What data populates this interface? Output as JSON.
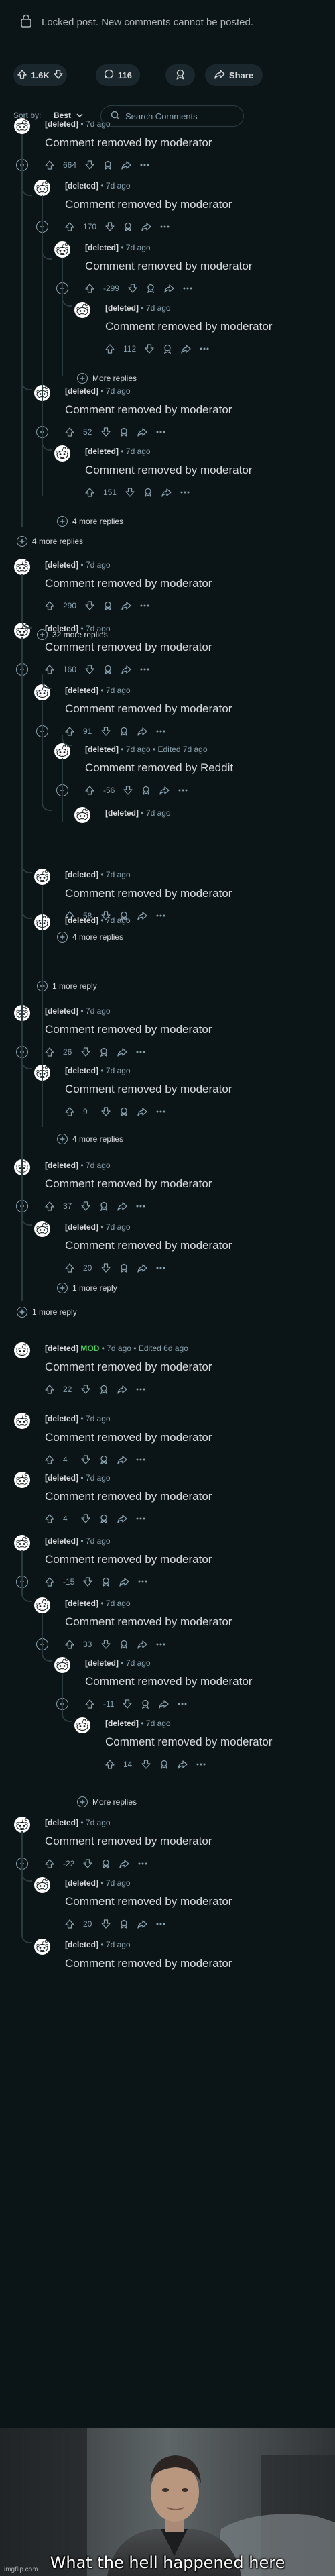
{
  "locked_notice": "Locked post. New comments cannot be posted.",
  "post_actions": {
    "vote_count": "1.6K",
    "comment_count": "116",
    "share_label": "Share"
  },
  "sort": {
    "label": "Sort by:",
    "value": "Best"
  },
  "search": {
    "placeholder": "Search Comments"
  },
  "comments": [
    {
      "author": "[deleted]",
      "time": "7d ago",
      "body": "Comment removed by moderator",
      "score": "664",
      "collapse": true
    },
    {
      "author": "[deleted]",
      "time": "7d ago",
      "body": "Comment removed by moderator",
      "score": "170",
      "collapse": true
    },
    {
      "author": "[deleted]",
      "time": "7d ago",
      "body": "Comment removed by moderator",
      "score": "-299",
      "collapse": true
    },
    {
      "author": "[deleted]",
      "time": "7d ago",
      "body": "Comment removed by moderator",
      "score": "112",
      "collapse": false
    },
    {
      "author": "[deleted]",
      "time": "7d ago",
      "body": "Comment removed by moderator",
      "score": "52",
      "collapse": true
    },
    {
      "author": "[deleted]",
      "time": "7d ago",
      "body": "Comment removed by moderator",
      "score": "151",
      "collapse": false
    },
    {
      "author": "[deleted]",
      "time": "7d ago",
      "body": "Comment removed by moderator",
      "score": "290",
      "collapse": false
    },
    {
      "author": "[deleted]",
      "time": "7d ago",
      "body": "Comment removed by moderator",
      "score": "160",
      "collapse": true
    },
    {
      "author": "[deleted]",
      "time": "7d ago",
      "body": "Comment removed by moderator",
      "score": "91",
      "collapse": true
    },
    {
      "author": "[deleted]",
      "time": "7d ago",
      "edited": "Edited 7d ago",
      "body": "Comment removed by Reddit",
      "score": "-56",
      "collapse": true
    },
    {
      "author": "[deleted]",
      "time": "7d ago",
      "body": "",
      "score": "",
      "collapse": false
    },
    {
      "author": "[deleted]",
      "time": "7d ago",
      "body": "Comment removed by moderator",
      "score": "58",
      "collapse": false
    },
    {
      "author": "[deleted]",
      "time": "7d ago",
      "body": "",
      "score": "",
      "collapse": false
    },
    {
      "author": "[deleted]",
      "time": "7d ago",
      "body": "Comment removed by moderator",
      "score": "26",
      "collapse": true
    },
    {
      "author": "[deleted]",
      "time": "7d ago",
      "body": "Comment removed by moderator",
      "score": "9",
      "collapse": false
    },
    {
      "author": "[deleted]",
      "time": "7d ago",
      "body": "Comment removed by moderator",
      "score": "37",
      "collapse": true
    },
    {
      "author": "[deleted]",
      "time": "7d ago",
      "body": "Comment removed by moderator",
      "score": "20",
      "collapse": false
    },
    {
      "author": "[deleted]",
      "mod": "MOD",
      "time": "7d ago",
      "edited": "Edited 6d ago",
      "body": "Comment removed by moderator",
      "score": "22",
      "collapse": false
    },
    {
      "author": "[deleted]",
      "time": "7d ago",
      "body": "Comment removed by moderator",
      "score": "4",
      "collapse": false
    },
    {
      "author": "[deleted]",
      "time": "7d ago",
      "body": "Comment removed by moderator",
      "score": "4",
      "collapse": false
    },
    {
      "author": "[deleted]",
      "time": "7d ago",
      "body": "Comment removed by moderator",
      "score": "-15",
      "collapse": true
    },
    {
      "author": "[deleted]",
      "time": "7d ago",
      "body": "Comment removed by moderator",
      "score": "33",
      "collapse": true
    },
    {
      "author": "[deleted]",
      "time": "7d ago",
      "body": "Comment removed by moderator",
      "score": "-11",
      "collapse": true
    },
    {
      "author": "[deleted]",
      "time": "7d ago",
      "body": "Comment removed by moderator",
      "score": "14",
      "collapse": false
    },
    {
      "author": "[deleted]",
      "time": "7d ago",
      "body": "Comment removed by moderator",
      "score": "-22",
      "collapse": true
    },
    {
      "author": "[deleted]",
      "time": "7d ago",
      "body": "Comment removed by moderator",
      "score": "20",
      "collapse": false
    },
    {
      "author": "[deleted]",
      "time": "7d ago",
      "body": "Comment removed by moderator",
      "score": "",
      "collapse": false
    }
  ],
  "more_links": [
    "More replies",
    "4 more replies",
    "4 more replies",
    "32 more replies",
    "4 more replies",
    "1 more reply",
    "4 more replies",
    "1 more reply",
    "1 more reply",
    "More replies"
  ],
  "meme": {
    "caption": "What the hell happened here",
    "watermark": "imgflip.com"
  },
  "colors": {
    "background": "#0b1416",
    "text": "#d7dadc",
    "muted": "#8ba2ad",
    "mod_green": "#46d160",
    "pill_bg": "#1a282d"
  }
}
